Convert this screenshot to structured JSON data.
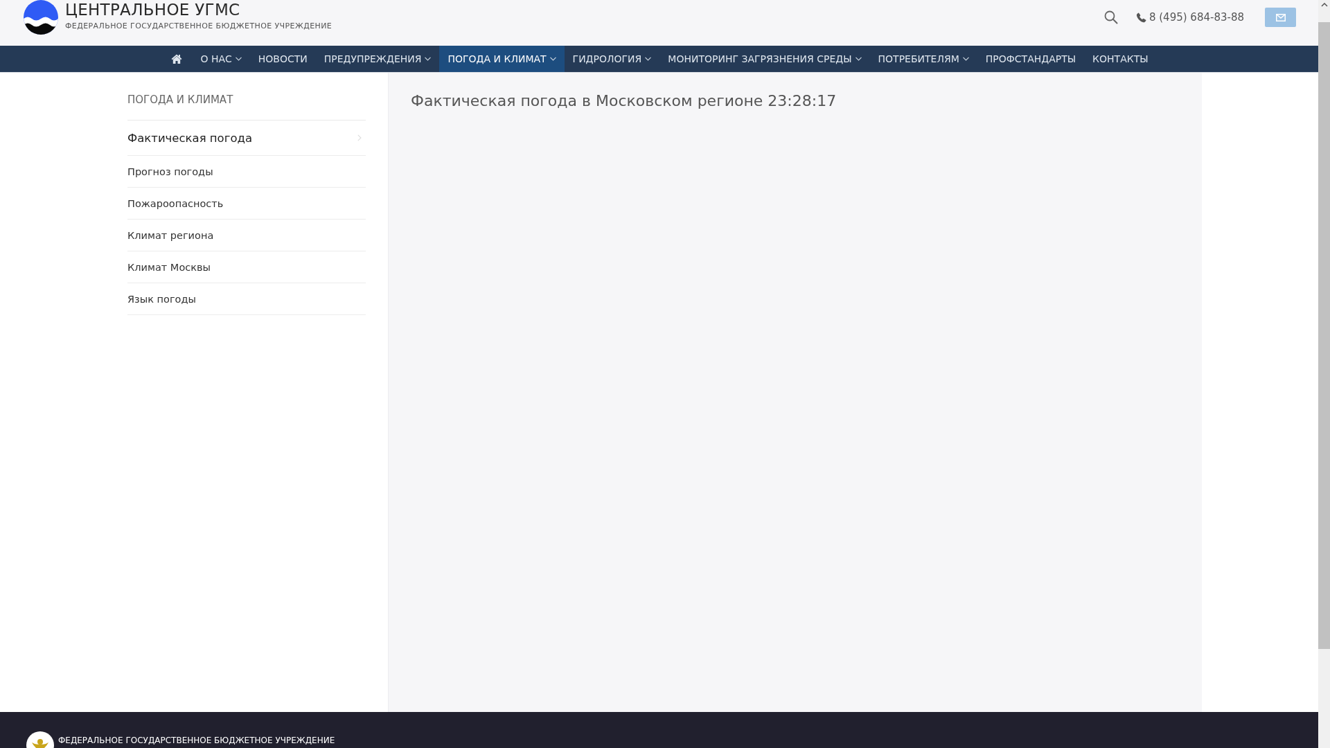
{
  "header": {
    "title": "ЦЕНТРАЛЬНОЕ УГМС",
    "subtitle": "ФЕДЕРАЛЬНОЕ ГОСУДАРСТВЕННОЕ БЮДЖЕТНОЕ УЧРЕЖДЕНИЕ",
    "phone": "8 (495) 684-83-88"
  },
  "nav": [
    {
      "kind": "home",
      "selected": false
    },
    {
      "kind": "text",
      "label": "О НАС",
      "has_menu": true,
      "selected": false
    },
    {
      "kind": "text",
      "label": "НОВОСТИ",
      "has_menu": false,
      "selected": false
    },
    {
      "kind": "text",
      "label": "ПРЕДУПРЕЖДЕНИЯ",
      "has_menu": true,
      "selected": false
    },
    {
      "kind": "text",
      "label": "ПОГОДА И КЛИМАТ",
      "has_menu": true,
      "selected": true
    },
    {
      "kind": "text",
      "label": "ГИДРОЛОГИЯ",
      "has_menu": true,
      "selected": false
    },
    {
      "kind": "text",
      "label": "МОНИТОРИНГ ЗАГРЯЗНЕНИЯ СРЕДЫ",
      "has_menu": true,
      "selected": false
    },
    {
      "kind": "text",
      "label": "ПОТРЕБИТЕЛЯМ",
      "has_menu": true,
      "selected": false
    },
    {
      "kind": "text",
      "label": "ПРОФСТАНДАРТЫ",
      "has_menu": false,
      "selected": false
    },
    {
      "kind": "text",
      "label": "КОНТАКТЫ",
      "has_menu": false,
      "selected": false
    }
  ],
  "sidebar": {
    "title": "ПОГОДА И КЛИМАТ",
    "items": [
      {
        "label": "Фактическая погода",
        "selected": true
      },
      {
        "label": "Прогноз погоды",
        "selected": false
      },
      {
        "label": "Пожароопасность",
        "selected": false
      },
      {
        "label": "Климат региона",
        "selected": false
      },
      {
        "label": "Климат Москвы",
        "selected": false
      },
      {
        "label": "Язык погоды",
        "selected": false
      }
    ]
  },
  "content": {
    "heading": "Фактическая погода в Московском регионе 23:28:17"
  },
  "footer": {
    "text": "ФЕДЕРАЛЬНОЕ ГОСУДАРСТВЕННОЕ БЮДЖЕТНОЕ УЧРЕЖДЕНИЕ"
  }
}
